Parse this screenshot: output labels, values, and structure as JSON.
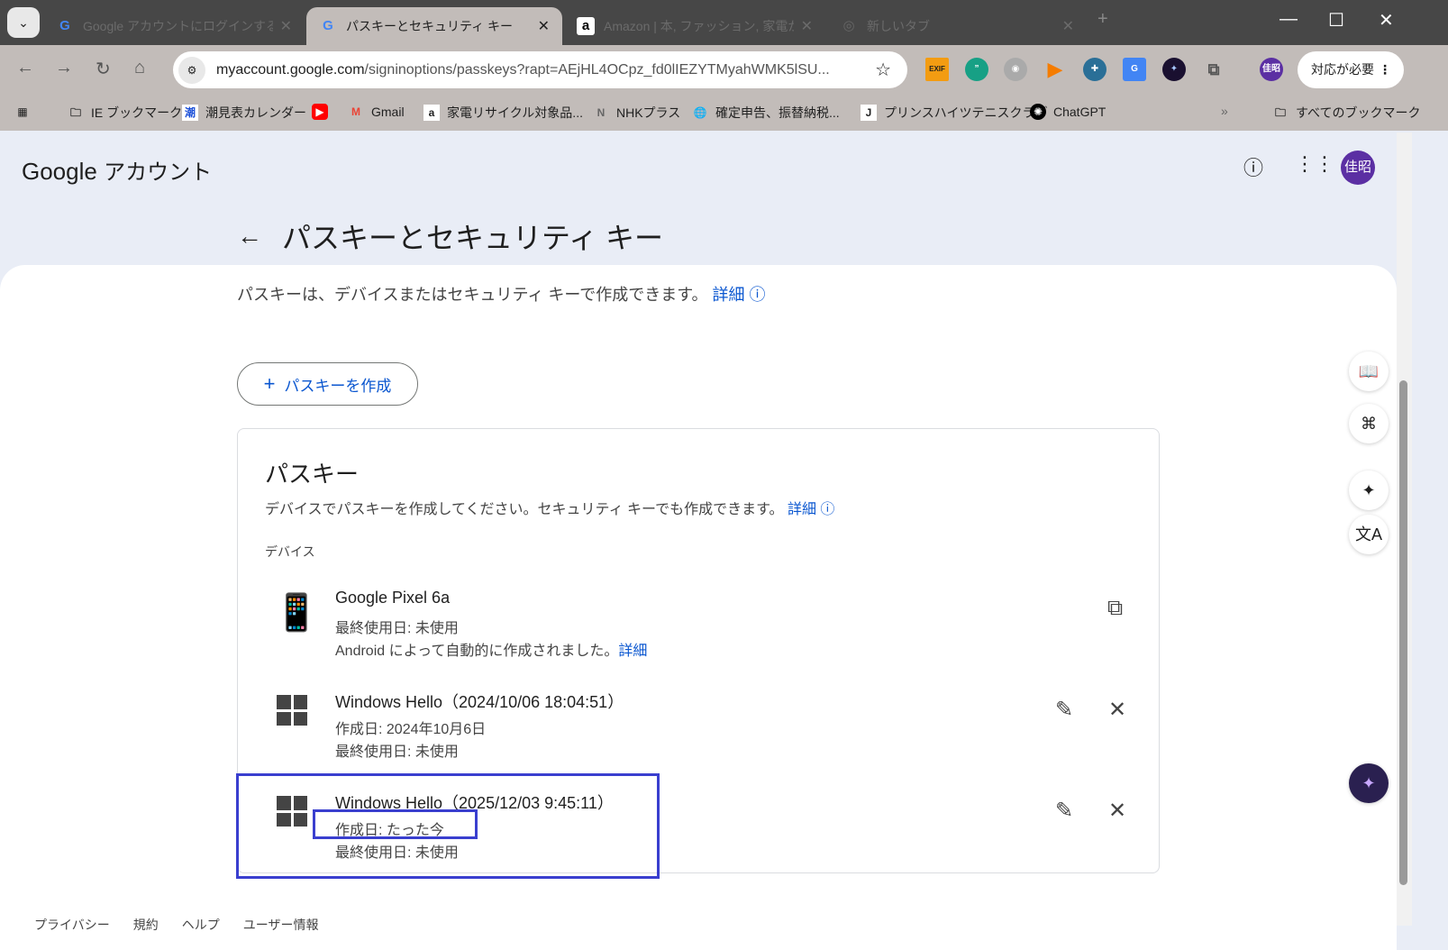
{
  "browser": {
    "tabs": [
      {
        "label": "Google アカウントにログインする",
        "icon": "google-icon"
      },
      {
        "label": "パスキーとセキュリティ キー",
        "icon": "google-icon"
      },
      {
        "label": "Amazon | 本, ファッション, 家電か",
        "icon": "amazon-icon"
      },
      {
        "label": "新しいタブ",
        "icon": "chrome-icon"
      }
    ],
    "url_host": "myaccount.google.com",
    "url_path": "/signinoptions/passkeys?rapt=AEjHL4OCpz_fd0lIEZYTMyahWMK5lSU...",
    "profile": "佳昭",
    "needs_action": "対応が必要",
    "ext_exif": "EXIF",
    "bookmarks": [
      "IE ブックマーク",
      "潮見表カレンダー",
      "Gmail",
      "家電リサイクル対象品...",
      "NHKプラス",
      "確定申告、振替納税...",
      "プリンスハイツテニスクラブ",
      "ChatGPT"
    ],
    "all_bookmarks": "すべてのブックマーク"
  },
  "header": {
    "logo": "Google",
    "product": "アカウント",
    "avatar": "佳昭"
  },
  "page": {
    "title": "パスキーとセキュリティ キー",
    "intro": "パスキーは、デバイスまたはセキュリティ キーで作成できます。",
    "details": "詳細",
    "create_button": "パスキーを作成",
    "card_title": "パスキー",
    "card_desc": "デバイスでパスキーを作成してください。セキュリティ キーでも作成できます。",
    "devices_label": "デバイス",
    "passkeys": [
      {
        "name": "Google Pixel 6a",
        "line1": "最終使用日: 未使用",
        "line2": "Android によって自動的に作成されました。",
        "line2_link": "詳細"
      },
      {
        "name": "Windows Hello（2024/10/06 18:04:51）",
        "line1": "作成日: 2024年10月6日",
        "line2": "最終使用日: 未使用"
      },
      {
        "name": "Windows Hello（2025/12/03 9:45:11）",
        "line1": "作成日: たった今",
        "line2": "最終使用日: 未使用"
      }
    ]
  },
  "footer": [
    "プライバシー",
    "規約",
    "ヘルプ",
    "ユーザー情報"
  ]
}
